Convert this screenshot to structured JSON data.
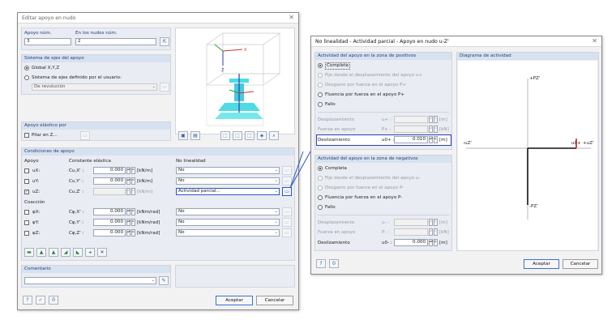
{
  "main": {
    "title": "Editar apoyo en nudo",
    "apoyo_num_label": "Apoyo núm.",
    "apoyo_num_value": "3",
    "nudos_label": "En los nudos núm.",
    "nudos_value": "2",
    "sistema_label": "Sistema de ejes del apoyo",
    "global_label": "Global X,Y,Z",
    "definido_label": "Sistema de ejes definido por el usuario:",
    "revolucion_value": "De revolución",
    "elastico_label": "Apoyo elástico por",
    "pilar_label": "Pilar en Z...",
    "condiciones_label": "Condiciones de apoyo",
    "col_apoyo": "Apoyo",
    "col_constante": "Constante elástica",
    "col_no_linealidad": "No linealidad",
    "rows": [
      {
        "sym": "uX:",
        "c": "Cu,X' :",
        "val": "0.000",
        "unit": "[kN/m]",
        "nl": "No",
        "checked": false
      },
      {
        "sym": "uY:",
        "c": "Cu,Y' :",
        "val": "0.000",
        "unit": "[kN/m]",
        "nl": "No",
        "checked": false
      },
      {
        "sym": "uZ:",
        "c": "Cu,Z' :",
        "val": "",
        "unit": "[kN/m]",
        "nl": "Actividad parcial...",
        "checked": true
      }
    ],
    "coaccion_label": "Coacción",
    "rot_rows": [
      {
        "sym": "φX:",
        "c": "Cφ,X' :",
        "val": "0.000",
        "unit": "[kNm/rad]",
        "nl": "No"
      },
      {
        "sym": "φY:",
        "c": "Cφ,Y' :",
        "val": "0.000",
        "unit": "[kNm/rad]",
        "nl": "No"
      },
      {
        "sym": "φZ:",
        "c": "Cφ,Z' :",
        "val": "0.000",
        "unit": "[kNm/rad]",
        "nl": "No"
      }
    ],
    "comentario_label": "Comentario",
    "aceptar": "Aceptar",
    "cancelar": "Cancelar",
    "help_icon": "help-icon",
    "zero_icon": "zero-value-icon"
  },
  "nl": {
    "title": "No linealidad - Actividad parcial - Apoyo en nudo u-Z'",
    "pos_header": "Actividad del apoyo en la zona de positivos",
    "pos_options": [
      "Completa",
      "Fijo desde el desplazamiento del apoyo u+",
      "Desgarro por fuerza en el apoyo P+",
      "Fluencia por fuerza en el apoyo P+",
      "Fallo"
    ],
    "pos_desp_label": "Desplazamiento",
    "pos_desp_sym": "u+ :",
    "pos_fuerza_label": "Fuerza en apoyo",
    "pos_fuerza_sym": "P+ :",
    "pos_desl_label": "Deslizamiento",
    "pos_desl_sym": "u0+ :",
    "pos_desl_value": "0.010",
    "neg_header": "Actividad del apoyo en la zona de negativos",
    "neg_options": [
      "Completa",
      "Fijo desde el desplazamiento del apoyo u-",
      "Desgarro por fuerza en el apoyo P-",
      "Fluencia por fuerza en el apoyo P-",
      "Fallo"
    ],
    "neg_desp_sym": "u- :",
    "neg_fuerza_sym": "P- :",
    "neg_desl_sym": "u0- :",
    "neg_desl_value": "0.000",
    "unit_m": "[m]",
    "unit_kn": "[kN]",
    "diagrama_label": "Diagrama de actividad",
    "d_pz": "+PZ'",
    "d_mpz": "-PZ'",
    "d_muz": "-uZ'",
    "d_u0": "u0+",
    "d_puz": "+uZ'",
    "aceptar": "Aceptar",
    "cancelar": "Cancelar"
  }
}
